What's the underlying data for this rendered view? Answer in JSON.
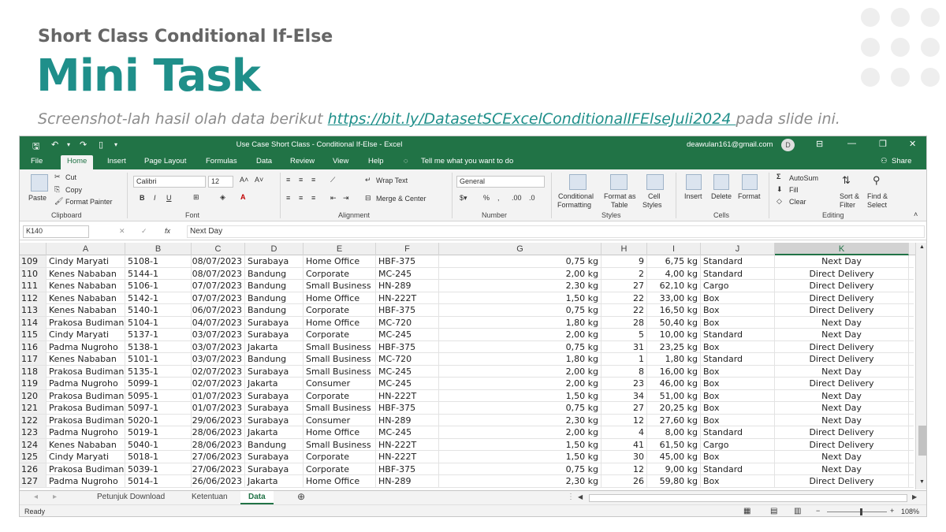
{
  "slide": {
    "kicker": "Short Class Conditional If-Else",
    "title": "Mini Task",
    "subtitle_prefix": "Screenshot-lah hasil olah data berikut ",
    "subtitle_link": "https://bit.ly/DatasetSCExcelConditionalIFElseJuli2024 ",
    "subtitle_suffix": "pada slide ini."
  },
  "excel": {
    "window_title": "Use Case Short Class - Conditional If-Else  -  Excel",
    "user_email": "deawulan161@gmail.com",
    "user_initial": "D",
    "tabs": [
      "File",
      "Home",
      "Insert",
      "Page Layout",
      "Formulas",
      "Data",
      "Review",
      "View",
      "Help"
    ],
    "active_tab": "Home",
    "tell_me": "Tell me what you want to do",
    "share": "Share",
    "ribbon": {
      "clipboard": {
        "paste": "Paste",
        "cut": "Cut",
        "copy": "Copy",
        "format_painter": "Format Painter",
        "label": "Clipboard"
      },
      "font": {
        "name": "Calibri",
        "size": "12",
        "label": "Font"
      },
      "alignment": {
        "wrap_text": "Wrap Text",
        "merge_center": "Merge & Center",
        "label": "Alignment"
      },
      "number": {
        "format": "General",
        "label": "Number"
      },
      "styles": {
        "conditional": "Conditional",
        "conditional2": "Formatting",
        "format_as": "Format as",
        "format_as2": "Table",
        "cell": "Cell",
        "cell2": "Styles",
        "label": "Styles"
      },
      "cells": {
        "insert": "Insert",
        "delete": "Delete",
        "format": "Format",
        "label": "Cells"
      },
      "editing": {
        "autosum": "AutoSum",
        "fill": "Fill",
        "clear": "Clear",
        "sort": "Sort &",
        "sort2": "Filter",
        "find": "Find &",
        "find2": "Select",
        "label": "Editing"
      }
    },
    "name_box": "K140",
    "formula_value": "Next Day",
    "columns": [
      "A",
      "B",
      "C",
      "D",
      "E",
      "F",
      "G",
      "H",
      "I",
      "J",
      "K"
    ],
    "selected_column": "K",
    "rows": [
      [
        "109",
        "Cindy Maryati",
        "5108-1",
        "08/07/2023",
        "Surabaya",
        "Home Office",
        "HBF-375",
        "0,75 kg",
        "9",
        "6,75 kg",
        "Standard",
        "Next Day"
      ],
      [
        "110",
        "Kenes Nababan",
        "5144-1",
        "08/07/2023",
        "Bandung",
        "Corporate",
        "MC-245",
        "2,00 kg",
        "2",
        "4,00 kg",
        "Standard",
        "Direct Delivery"
      ],
      [
        "111",
        "Kenes Nababan",
        "5106-1",
        "07/07/2023",
        "Bandung",
        "Small Business",
        "HN-289",
        "2,30 kg",
        "27",
        "62,10 kg",
        "Cargo",
        "Direct Delivery"
      ],
      [
        "112",
        "Kenes Nababan",
        "5142-1",
        "07/07/2023",
        "Bandung",
        "Home Office",
        "HN-222T",
        "1,50 kg",
        "22",
        "33,00 kg",
        "Box",
        "Direct Delivery"
      ],
      [
        "113",
        "Kenes Nababan",
        "5140-1",
        "06/07/2023",
        "Bandung",
        "Corporate",
        "HBF-375",
        "0,75 kg",
        "22",
        "16,50 kg",
        "Box",
        "Direct Delivery"
      ],
      [
        "114",
        "Prakosa Budiman",
        "5104-1",
        "04/07/2023",
        "Surabaya",
        "Home Office",
        "MC-720",
        "1,80 kg",
        "28",
        "50,40 kg",
        "Box",
        "Next Day"
      ],
      [
        "115",
        "Cindy Maryati",
        "5137-1",
        "03/07/2023",
        "Surabaya",
        "Corporate",
        "MC-245",
        "2,00 kg",
        "5",
        "10,00 kg",
        "Standard",
        "Next Day"
      ],
      [
        "116",
        "Padma Nugroho",
        "5138-1",
        "03/07/2023",
        "Jakarta",
        "Small Business",
        "HBF-375",
        "0,75 kg",
        "31",
        "23,25 kg",
        "Box",
        "Direct Delivery"
      ],
      [
        "117",
        "Kenes Nababan",
        "5101-1",
        "03/07/2023",
        "Bandung",
        "Small Business",
        "MC-720",
        "1,80 kg",
        "1",
        "1,80 kg",
        "Standard",
        "Direct Delivery"
      ],
      [
        "118",
        "Prakosa Budiman",
        "5135-1",
        "02/07/2023",
        "Surabaya",
        "Small Business",
        "MC-245",
        "2,00 kg",
        "8",
        "16,00 kg",
        "Box",
        "Next Day"
      ],
      [
        "119",
        "Padma Nugroho",
        "5099-1",
        "02/07/2023",
        "Jakarta",
        "Consumer",
        "MC-245",
        "2,00 kg",
        "23",
        "46,00 kg",
        "Box",
        "Direct Delivery"
      ],
      [
        "120",
        "Prakosa Budiman",
        "5095-1",
        "01/07/2023",
        "Surabaya",
        "Corporate",
        "HN-222T",
        "1,50 kg",
        "34",
        "51,00 kg",
        "Box",
        "Next Day"
      ],
      [
        "121",
        "Prakosa Budiman",
        "5097-1",
        "01/07/2023",
        "Surabaya",
        "Small Business",
        "HBF-375",
        "0,75 kg",
        "27",
        "20,25 kg",
        "Box",
        "Next Day"
      ],
      [
        "122",
        "Prakosa Budiman",
        "5020-1",
        "29/06/2023",
        "Surabaya",
        "Consumer",
        "HN-289",
        "2,30 kg",
        "12",
        "27,60 kg",
        "Box",
        "Next Day"
      ],
      [
        "123",
        "Padma Nugroho",
        "5019-1",
        "28/06/2023",
        "Jakarta",
        "Home Office",
        "MC-245",
        "2,00 kg",
        "4",
        "8,00 kg",
        "Standard",
        "Direct Delivery"
      ],
      [
        "124",
        "Kenes Nababan",
        "5040-1",
        "28/06/2023",
        "Bandung",
        "Small Business",
        "HN-222T",
        "1,50 kg",
        "41",
        "61,50 kg",
        "Cargo",
        "Direct Delivery"
      ],
      [
        "125",
        "Cindy Maryati",
        "5018-1",
        "27/06/2023",
        "Surabaya",
        "Corporate",
        "HN-222T",
        "1,50 kg",
        "30",
        "45,00 kg",
        "Box",
        "Next Day"
      ],
      [
        "126",
        "Prakosa Budiman",
        "5039-1",
        "27/06/2023",
        "Surabaya",
        "Corporate",
        "HBF-375",
        "0,75 kg",
        "12",
        "9,00 kg",
        "Standard",
        "Next Day"
      ],
      [
        "127",
        "Padma Nugroho",
        "5014-1",
        "26/06/2023",
        "Jakarta",
        "Home Office",
        "HN-289",
        "2,30 kg",
        "26",
        "59,80 kg",
        "Box",
        "Direct Delivery"
      ]
    ],
    "sheets": [
      "Petunjuk Download",
      "Ketentuan",
      "Data"
    ],
    "active_sheet": "Data",
    "status": "Ready",
    "zoom": "108%"
  }
}
